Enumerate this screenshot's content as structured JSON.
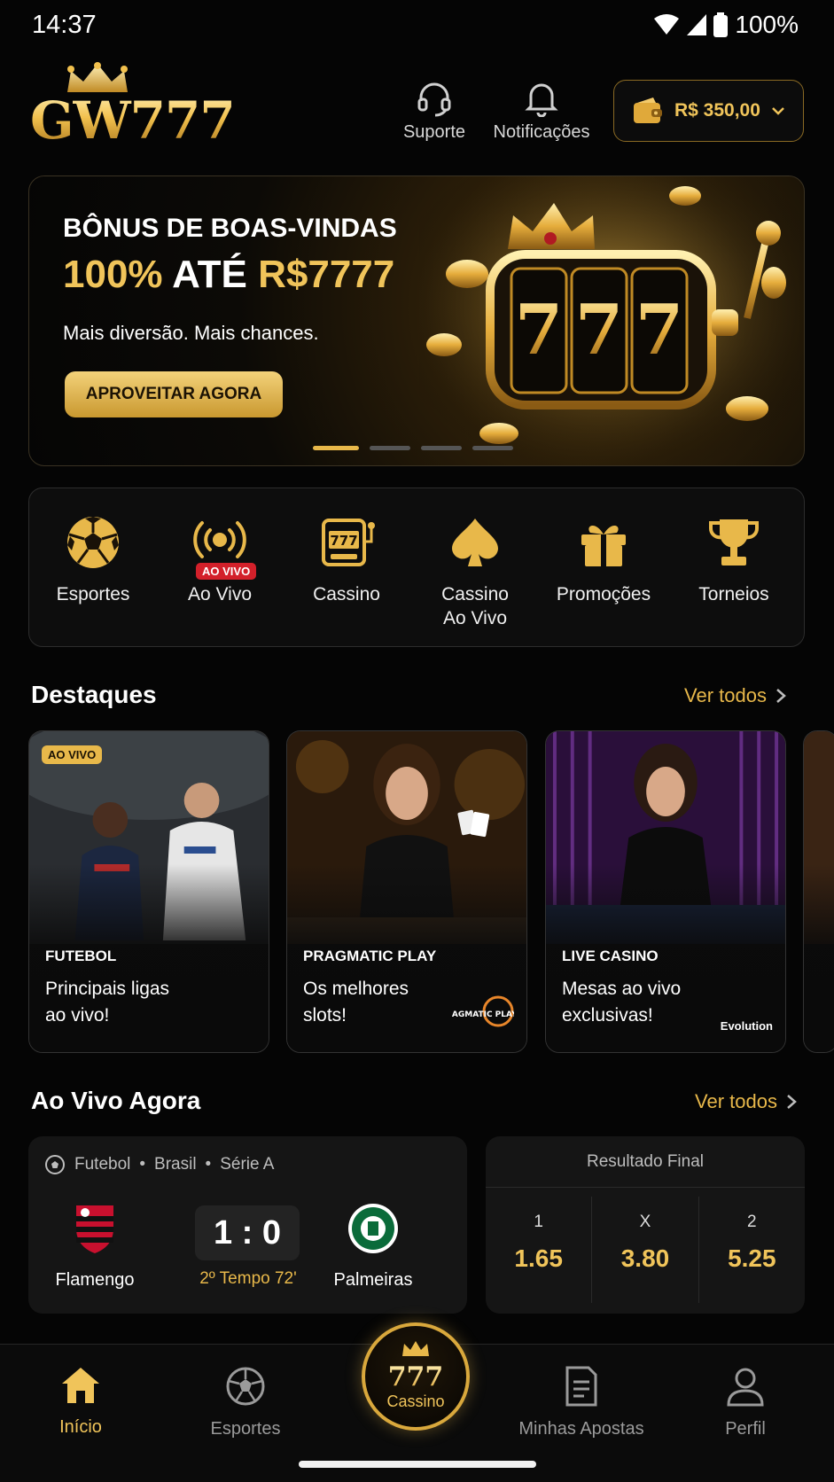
{
  "status_bar": {
    "time": "14:37",
    "battery": "100%"
  },
  "header": {
    "logo_text": "GW777",
    "support_label": "Suporte",
    "notifications_label": "Notificações",
    "balance": "R$ 350,00"
  },
  "banner": {
    "title_line1": "BÔNUS DE BOAS-VINDAS",
    "title_line2_a": "100%",
    "title_line2_b": "ATÉ",
    "title_line2_c": "R$7777",
    "subtitle": "Mais diversão. Mais chances.",
    "cta": "APROVEITAR AGORA",
    "slides_total": 4,
    "slide_active": 1
  },
  "categories": [
    {
      "label": "Esportes",
      "icon": "soccer-ball-icon"
    },
    {
      "label": "Ao Vivo",
      "icon": "live-broadcast-icon",
      "tag": "AO VIVO"
    },
    {
      "label": "Cassino",
      "icon": "slot-machine-icon"
    },
    {
      "label": "Cassino",
      "label2": "Ao Vivo",
      "icon": "spade-icon"
    },
    {
      "label": "Promoções",
      "icon": "gift-icon"
    },
    {
      "label": "Torneios",
      "icon": "trophy-icon"
    }
  ],
  "highlights": {
    "title": "Destaques",
    "see_all": "Ver todos",
    "cards": [
      {
        "tag": "AO VIVO",
        "category": "FUTEBOL",
        "text_line1": "Principais ligas",
        "text_line2": "ao vivo!",
        "brand": ""
      },
      {
        "tag": "",
        "category": "PRAGMATIC PLAY",
        "text_line1": "Os melhores",
        "text_line2": "slots!",
        "brand": "PRAGMATIC PLAY"
      },
      {
        "tag": "",
        "category": "LIVE CASINO",
        "text_line1": "Mesas ao vivo",
        "text_line2": "exclusivas!",
        "brand": "Evolution"
      }
    ]
  },
  "live_now": {
    "title": "Ao Vivo Agora",
    "see_all": "Ver todos",
    "match": {
      "sport": "Futebol",
      "country": "Brasil",
      "league": "Série A",
      "home_team": "Flamengo",
      "away_team": "Palmeiras",
      "score": "1 : 0",
      "time": "2º Tempo 72'"
    },
    "odds": {
      "title": "Resultado Final",
      "items": [
        {
          "label": "1",
          "value": "1.65"
        },
        {
          "label": "X",
          "value": "3.80"
        },
        {
          "label": "2",
          "value": "5.25"
        }
      ]
    }
  },
  "bottom_nav": {
    "home": "Início",
    "sports": "Esportes",
    "casino_number": "777",
    "casino": "Cassino",
    "my_bets": "Minhas Apostas",
    "profile": "Perfil"
  },
  "colors": {
    "accent": "#e8b84a",
    "background": "#050505",
    "live_red": "#d3202a"
  }
}
